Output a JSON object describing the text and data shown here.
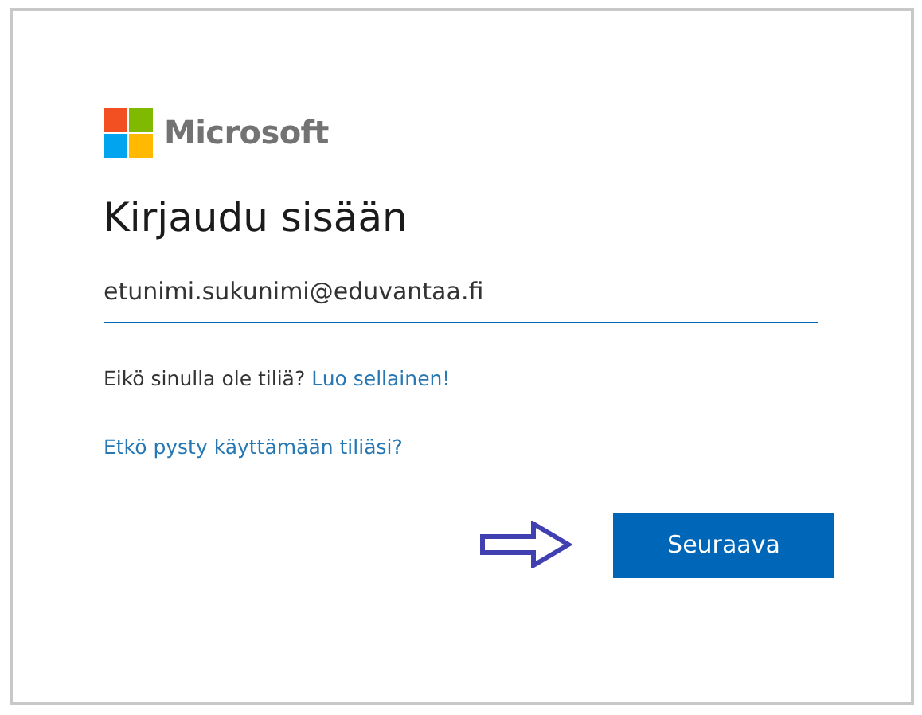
{
  "brand": {
    "name": "Microsoft"
  },
  "title": "Kirjaudu sisään",
  "email": {
    "value": "etunimi.sukunimi@eduvantaa.fi",
    "focused": true
  },
  "no_account": {
    "text": "Eikö sinulla ole tiliä?",
    "link": "Luo sellainen!"
  },
  "cant_access_link": "Etkö pysty käyttämään tiliäsi?",
  "next_button": "Seuraava"
}
